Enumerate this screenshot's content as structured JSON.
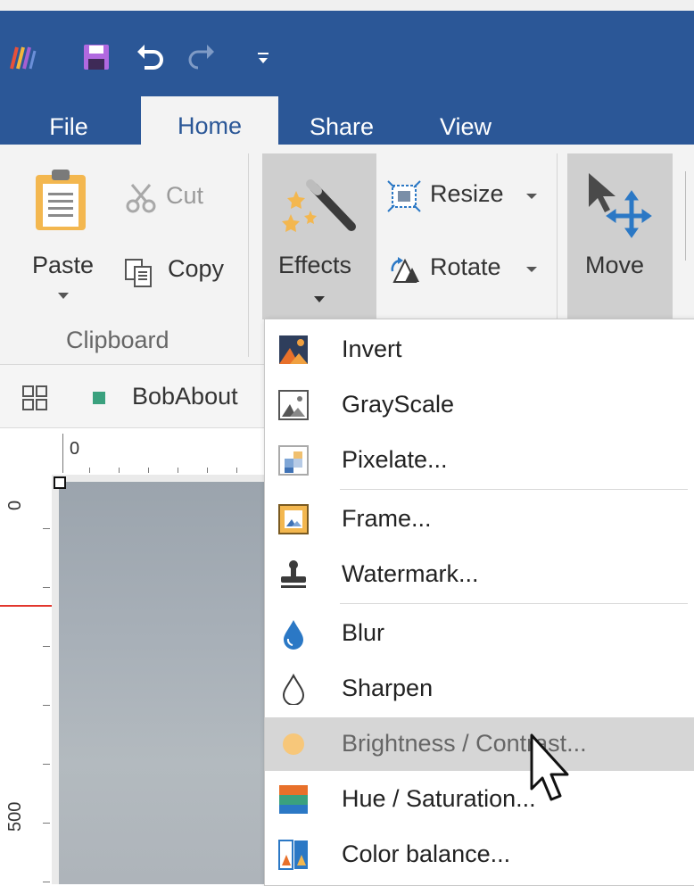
{
  "colors": {
    "accent": "#2b5797",
    "ribbon_bg": "#f3f3f3",
    "menu_highlight": "#d6d6d6"
  },
  "qat": {
    "app_icon": "app-logo-icon",
    "save_icon": "save-icon",
    "undo_icon": "undo-icon",
    "redo_icon": "redo-icon",
    "customize_icon": "customize-qat-icon"
  },
  "tabs": [
    {
      "label": "File"
    },
    {
      "label": "Home"
    },
    {
      "label": "Share"
    },
    {
      "label": "View"
    }
  ],
  "ribbon": {
    "paste_label": "Paste",
    "cut_label": "Cut",
    "copy_label": "Copy",
    "clipboard_group": "Clipboard",
    "effects_label": "Effects",
    "resize_label": "Resize",
    "rotate_label": "Rotate",
    "move_label": "Move"
  },
  "document": {
    "tab_label": "BobAbout"
  },
  "ruler": {
    "h_zero": "0",
    "v_zero": "0",
    "v_500": "500"
  },
  "effects_menu": {
    "items": [
      {
        "label": "Invert",
        "icon": "invert-icon"
      },
      {
        "label": "GrayScale",
        "icon": "grayscale-icon"
      },
      {
        "label": "Pixelate...",
        "icon": "pixelate-icon"
      },
      {
        "label": "Frame...",
        "icon": "frame-icon"
      },
      {
        "label": "Watermark...",
        "icon": "watermark-icon"
      },
      {
        "label": "Blur",
        "icon": "blur-icon"
      },
      {
        "label": "Sharpen",
        "icon": "sharpen-icon"
      },
      {
        "label": "Brightness / Contrast...",
        "icon": "brightness-icon",
        "highlighted": true
      },
      {
        "label": "Hue / Saturation...",
        "icon": "hue-saturation-icon"
      },
      {
        "label": "Color balance...",
        "icon": "color-balance-icon"
      }
    ]
  }
}
